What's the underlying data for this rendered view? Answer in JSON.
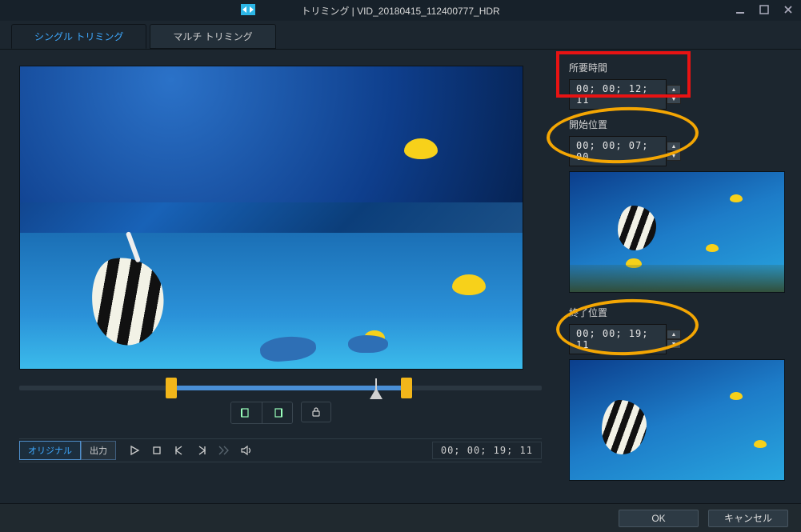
{
  "titlebar": {
    "title": "トリミング | VID_20180415_112400777_HDR"
  },
  "tabs": {
    "single": "シングル トリミング",
    "multi": "マルチ トリミング"
  },
  "markin_out": {
    "lock_tooltip": "Lock"
  },
  "bottom": {
    "original": "オリジナル",
    "output": "出力",
    "timecode": "00; 00; 19; 11"
  },
  "right": {
    "duration_label": "所要時間",
    "duration_value": "00; 00; 12; 11",
    "start_label": "開始位置",
    "start_value": "00; 00; 07; 00",
    "end_label": "終了位置",
    "end_value": "00; 00; 19; 11"
  },
  "footer": {
    "ok": "OK",
    "cancel": "キャンセル"
  }
}
